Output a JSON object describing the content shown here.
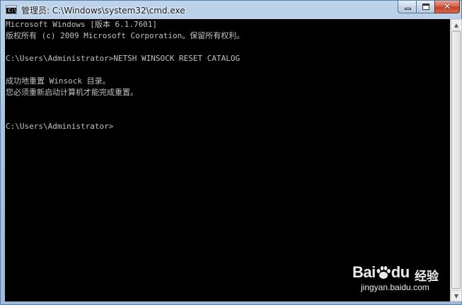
{
  "window": {
    "title": "管理员: C:\\Windows\\system32\\cmd.exe",
    "icon": "cmd-icon",
    "icon_text": "C:\\.",
    "controls": {
      "close_symbol": "✕"
    }
  },
  "console": {
    "lines": [
      "Microsoft Windows [版本 6.1.7601]",
      "版权所有 (c) 2009 Microsoft Corporation。保留所有权利。",
      "",
      "C:\\Users\\Administrator>NETSH WINSOCK RESET CATALOG",
      "",
      "成功地重置 Winsock 目录。",
      "您必须重新启动计算机才能完成重置。",
      "",
      "",
      "C:\\Users\\Administrator>"
    ],
    "text_color": "#c0c0c0",
    "background": "#000000"
  },
  "scrollbar": {
    "up_symbol": "▲",
    "down_symbol": "▼"
  },
  "watermark": {
    "logo_left": "Bai",
    "logo_right": "du",
    "tag": "经验",
    "url": "jingyan.baidu.com"
  }
}
